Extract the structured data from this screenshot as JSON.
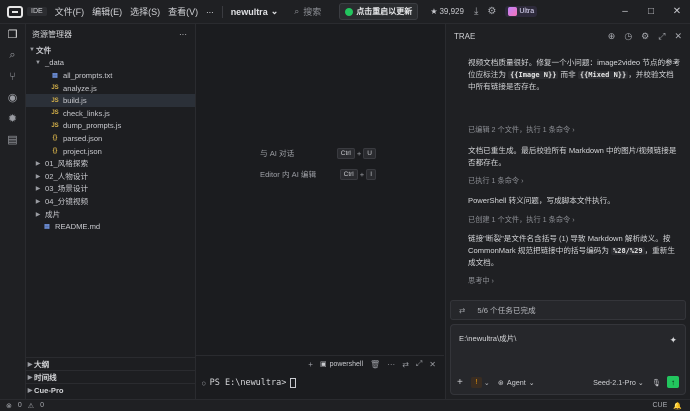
{
  "titlebar": {
    "ide_badge": "IDE",
    "menu": [
      "文件(F)",
      "编辑(E)",
      "选择(S)",
      "查看(V)"
    ],
    "more": "...",
    "project": "newultra",
    "search": "搜索",
    "update": "点击重启以更新",
    "stars": "39,929",
    "plan": "Ultra"
  },
  "sidebar": {
    "title": "资源管理器",
    "root": "文件",
    "items": [
      {
        "label": "_data",
        "type": "dir",
        "open": true,
        "depth": 1
      },
      {
        "label": "all_prompts.txt",
        "type": "txt",
        "depth": 2
      },
      {
        "label": "analyze.js",
        "type": "js",
        "depth": 2
      },
      {
        "label": "build.js",
        "type": "js",
        "depth": 2,
        "selected": true
      },
      {
        "label": "check_links.js",
        "type": "js",
        "depth": 2
      },
      {
        "label": "dump_prompts.js",
        "type": "js",
        "depth": 2
      },
      {
        "label": "parsed.json",
        "type": "json",
        "depth": 2
      },
      {
        "label": "project.json",
        "type": "json",
        "depth": 2
      },
      {
        "label": "01_风格探索",
        "type": "dir",
        "depth": 1
      },
      {
        "label": "02_人物设计",
        "type": "dir",
        "depth": 1
      },
      {
        "label": "03_场景设计",
        "type": "dir",
        "depth": 1
      },
      {
        "label": "04_分镜视频",
        "type": "dir",
        "depth": 1
      },
      {
        "label": "成片",
        "type": "dir",
        "depth": 1
      },
      {
        "label": "README.md",
        "type": "md",
        "depth": 1
      }
    ],
    "outline": "大纲",
    "timeline": "时间线",
    "cue": "Cue-Pro"
  },
  "editor": {
    "shortcuts": [
      {
        "label": "与 AI 对话",
        "k1": "Ctrl",
        "k2": "U"
      },
      {
        "label": "Editor 内 AI 编辑",
        "k1": "Ctrl",
        "k2": "I"
      }
    ]
  },
  "terminal": {
    "shell": "powershell",
    "prompt": "PS E:\\newultra>"
  },
  "chat": {
    "title": "TRAE",
    "m1_a": "视频文档质量很好。修复一个小问题：image2video 节点的参考位应标注为 ",
    "m1_code1": "{{Image N}}",
    "m1_b": " 而非 ",
    "m1_code2": "{{Mixed N}}",
    "m1_c": "，并校验文档中所有链接是否存在。",
    "meta1": "已编辑 2 个文件，执行 1 条命令 ›",
    "m2": "文档已重生成。最后校验所有 Markdown 中的图片/视频链接是否都存在。",
    "meta2": "已执行 1 条命令 ›",
    "m3": "PowerShell 转义问题，写成脚本文件执行。",
    "meta3": "已创建 1 个文件，执行 1 条命令 ›",
    "m4_a": "链接\"断裂\"是文件名含括号 (1) 导致 Markdown 解析歧义。按 CommonMark 规范把链接中的括号编码为 ",
    "m4_code": "%28/%29",
    "m4_b": "，重新生成文档。",
    "thinking": "思考中 ›",
    "task_icon": "⇄",
    "task": "5/6 个任务已完成",
    "input_value": "E:\\newultra\\成片\\",
    "agent": "Agent",
    "model": "Seed-2.1-Pro"
  },
  "statusbar": {
    "errors": "0",
    "warnings": "0",
    "cue": "CUE"
  }
}
